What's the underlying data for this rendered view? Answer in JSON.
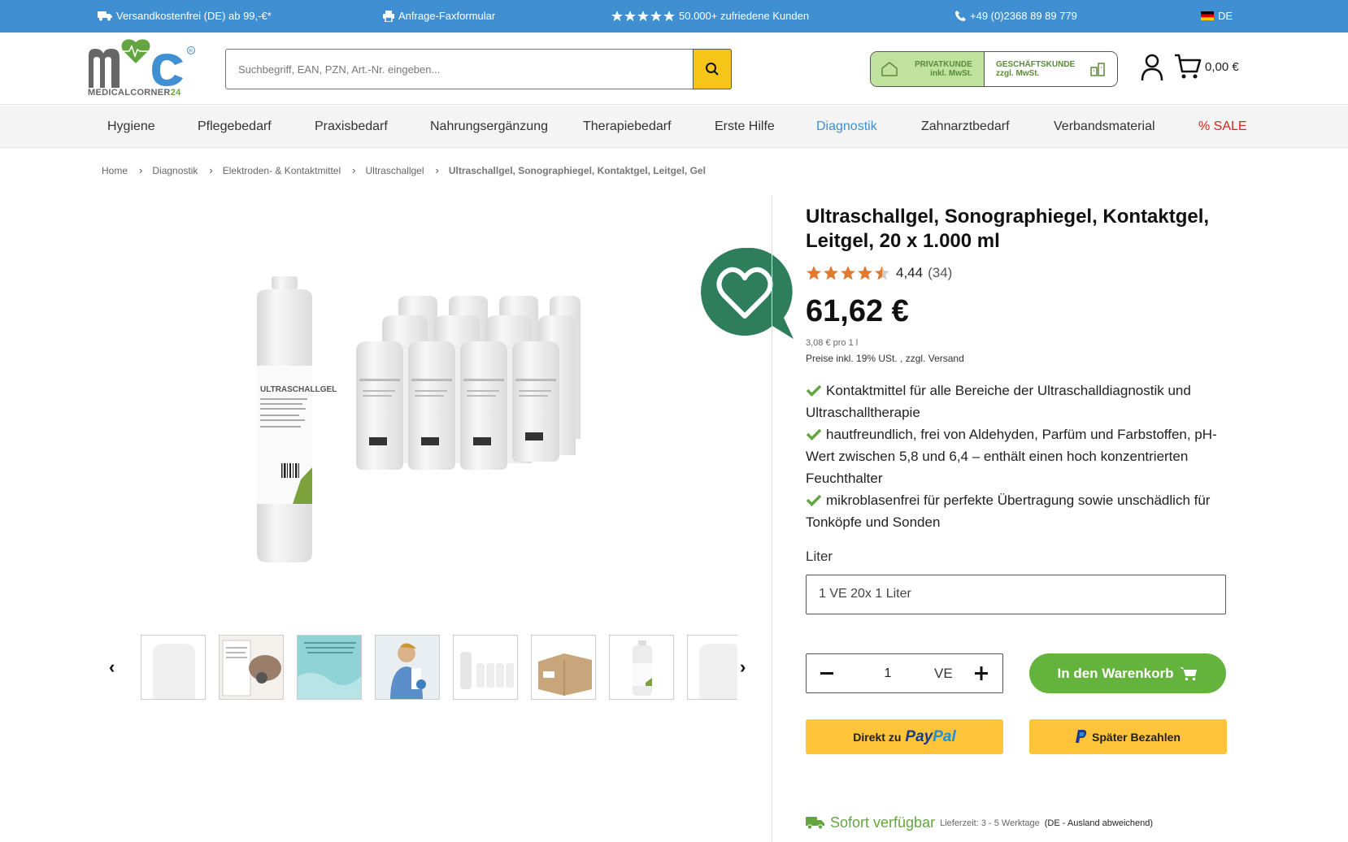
{
  "topbar": {
    "shipping": "Versandkostenfrei (DE) ab 99,-€*",
    "fax": "Anfrage-Faxformular",
    "customers": "50.000+ zufriedene Kunden",
    "phone": "+49 (0)2368 89 89 779",
    "lang": "DE"
  },
  "header": {
    "logo_text_prefix": "MEDICALCORNER",
    "logo_text_suffix": "24",
    "search_placeholder": "Suchbegriff, EAN, PZN, Art.-Nr. eingeben...",
    "private_label_1": "PRIVATKUNDE",
    "private_label_2": "inkl. MwSt.",
    "business_label_1": "GESCHÄFTSKUNDE",
    "business_label_2": "zzgl. MwSt.",
    "cart_amount": "0,00 €"
  },
  "nav": [
    {
      "label": "Hygiene"
    },
    {
      "label": "Pflegebedarf"
    },
    {
      "label": "Praxisbedarf"
    },
    {
      "label": "Nahrungsergänzung"
    },
    {
      "label": "Therapiebedarf"
    },
    {
      "label": "Erste Hilfe"
    },
    {
      "label": "Diagnostik"
    },
    {
      "label": "Zahnarztbedarf"
    },
    {
      "label": "Verbandsmaterial"
    },
    {
      "label": "% SALE"
    }
  ],
  "breadcrumb": [
    "Home",
    "Diagnostik",
    "Elektroden- & Kontaktmittel",
    "Ultraschallgel",
    "Ultraschallgel, Sonographiegel, Kontaktgel, Leitgel, Gel"
  ],
  "product": {
    "title": "Ultraschallgel, Sonographiegel, Kontaktgel, Leitgel, 20 x 1.000 ml",
    "rating_stars": 4.44,
    "rating_value": "4,44",
    "rating_count": "(34)",
    "price": "61,62 €",
    "unit_price": "3,08 € pro 1 l",
    "tax_note": "Preise inkl. 19% USt. , zzgl. Versand",
    "bottle_label": "ULTRASCHALLGEL",
    "bullets": [
      "Kontaktmittel für alle Bereiche der Ultraschalldiagnostik und Ultraschalltherapie",
      "hautfreundlich, frei von Aldehyden, Parfüm und Farbstoffen, pH-Wert zwischen 5,8 und 6,4 – enthält einen hoch konzentrierten Feuchthalter",
      "mikroblasenfrei für perfekte Übertragung sowie unschädlich für Tonköpfe und Sonden"
    ],
    "variant_label": "Liter",
    "variant_value": "1 VE 20x 1 Liter",
    "quantity": "1",
    "quantity_unit": "VE",
    "add_to_cart": "In den Warenkorb",
    "paypal_prefix": "Direkt zu",
    "paypal_brand_a": "Pay",
    "paypal_brand_b": "Pal",
    "paylater": "Später Bezahlen",
    "availability": "Sofort verfügbar",
    "lead_time": "Lieferzeit: 3 - 5 Werktage",
    "abroad_note": "(DE - Ausland abweichend)"
  },
  "colors": {
    "topbar": "#3f8fd2",
    "brand_green": "#63a541",
    "accent_yellow": "#f5c518",
    "wishlist_green": "#2e7d5b",
    "sale_red": "#d9251d"
  }
}
